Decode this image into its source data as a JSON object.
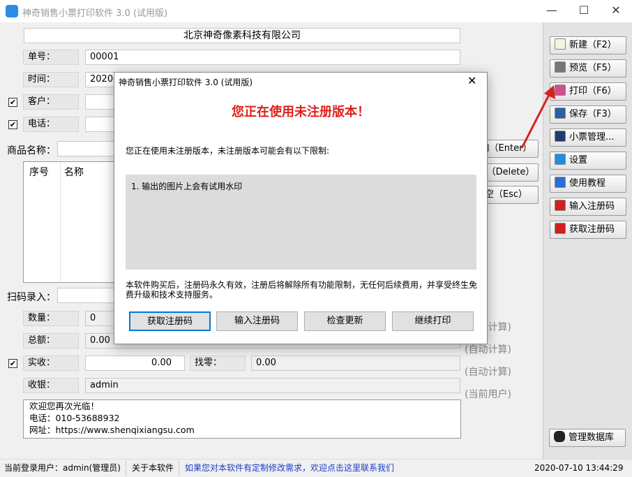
{
  "window": {
    "title": "神奇销售小票打印软件 3.0 (试用版)",
    "minimize": "—",
    "maximize": "☐",
    "close": "✕"
  },
  "form": {
    "company": "北京神奇像素科技有限公司",
    "order_label": "单号：",
    "order_value": "00001",
    "time_label": "时间：",
    "time_value": "2020-0",
    "customer_label": "客户：",
    "phone_label": "电话：",
    "checked": "✔",
    "product_label": "商品名称：",
    "table_headers": [
      "序号",
      "名称"
    ],
    "scan_label": "扫码录入：",
    "qty_label": "数量：",
    "qty_value": "0",
    "total_label": "总额：",
    "total_value": "0.00",
    "paid_label": "实收：",
    "paid_value": "0.00",
    "change_label": "找零：",
    "change_value": "0.00",
    "cashier_label": "收银：",
    "cashier_value": "admin",
    "auto1": "(自动计算)",
    "auto2": "(自动计算)",
    "auto3": "(自动计算)",
    "current_user": "(当前用户)",
    "add_button": "添加（Enter）",
    "delete_button": "删除（Delete）",
    "clear_button": "清空（Esc）",
    "footer_lines": [
      "欢迎您再次光临！",
      "电话：010-53688932",
      "网址：https://www.shenqixiangsu.com"
    ]
  },
  "sidebar": {
    "buttons": [
      {
        "label": "新建（F2）",
        "icon": "new-doc-icon",
        "color": "#f3f3e0"
      },
      {
        "label": "预览（F5）",
        "icon": "printer-preview-icon",
        "color": "#777777"
      },
      {
        "label": "打印（F6）",
        "icon": "printer-icon",
        "color": "#d0508a"
      },
      {
        "label": "保存（F3）",
        "icon": "save-icon",
        "color": "#2b5ea8"
      },
      {
        "label": "小票管理...",
        "icon": "search-icon",
        "color": "#1e3d6e"
      },
      {
        "label": "设置",
        "icon": "gear-icon",
        "color": "#1f8de0"
      },
      {
        "label": "使用教程",
        "icon": "book-icon",
        "color": "#2a6fd6"
      },
      {
        "label": "输入注册码",
        "icon": "key-icon",
        "color": "#d02020"
      },
      {
        "label": "获取注册码",
        "icon": "cart-icon",
        "color": "#d02020"
      }
    ],
    "db_button": "管理数据库"
  },
  "status": {
    "user": "当前登录用户：admin(管理员)",
    "about": "关于本软件",
    "link": "如果您对本软件有定制修改需求，欢迎点击这里联系我们",
    "datetime": "2020-07-10 13:44:29"
  },
  "dialog": {
    "title": "神奇销售小票打印软件 3.0 (试用版)",
    "close": "✕",
    "heading": "您正在使用未注册版本！",
    "intro": "您正在使用未注册版本，未注册版本可能会有以下限制:",
    "limits": [
      "1. 输出的图片上会有试用水印"
    ],
    "note": "本软件购买后，注册码永久有效，注册后将解除所有功能限制，无任何后续费用，并享受终生免费升级和技术支持服务。",
    "buttons": [
      "获取注册码",
      "输入注册码",
      "检查更新",
      "继续打印"
    ],
    "heading_color": "#e0201c"
  },
  "annotation_color": "#d82020"
}
